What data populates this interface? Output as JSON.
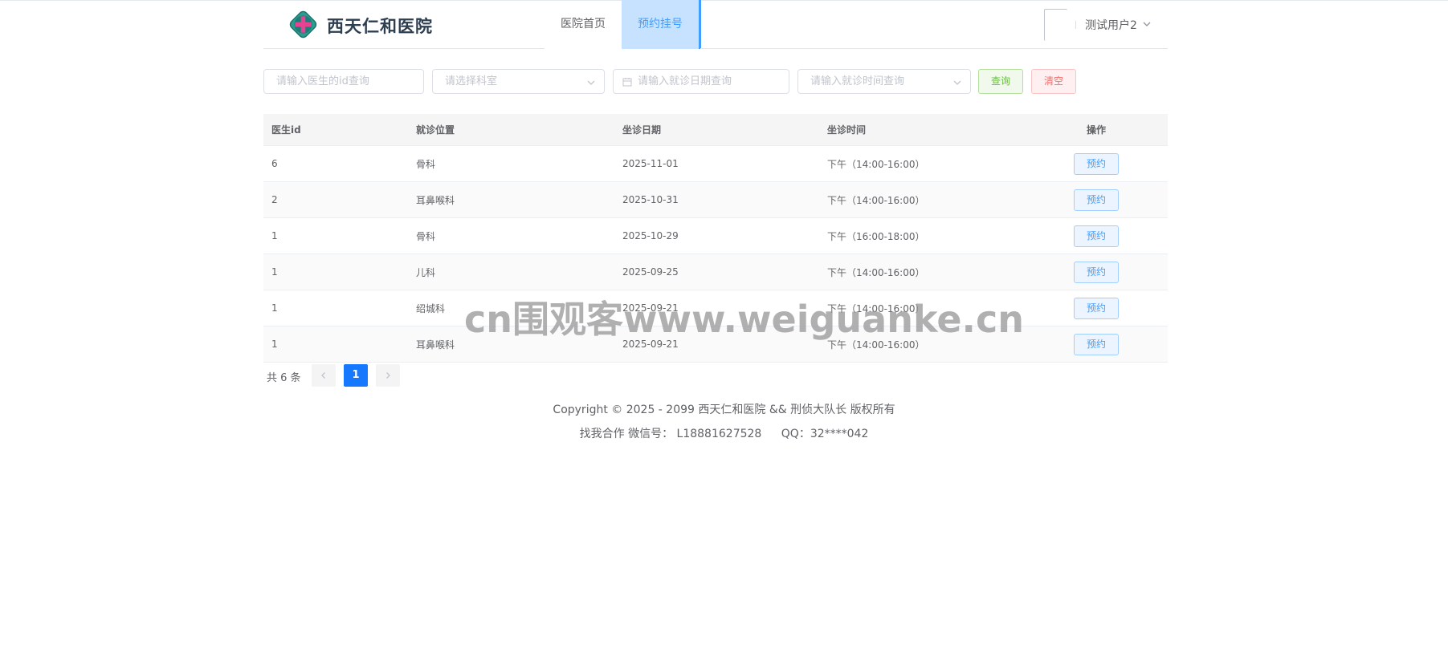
{
  "header": {
    "brand": "西天仁和医院",
    "nav": [
      {
        "label": "医院首页",
        "active": false
      },
      {
        "label": "预约挂号",
        "active": true
      }
    ],
    "user": "测试用户2"
  },
  "filters": {
    "doctor_id_placeholder": "请输入医生的id查询",
    "dept_placeholder": "请选择科室",
    "date_placeholder": "请输入就诊日期查询",
    "time_placeholder": "请输入就诊时间查询",
    "query_label": "查询",
    "clear_label": "清空"
  },
  "table": {
    "headers": [
      "医生id",
      "就诊位置",
      "坐诊日期",
      "坐诊时间",
      "操作"
    ],
    "rows": [
      {
        "id": "6",
        "location": "骨科",
        "date": "2025-11-01",
        "time": "下午（14:00-16:00）",
        "action": "预约"
      },
      {
        "id": "2",
        "location": "耳鼻喉科",
        "date": "2025-10-31",
        "time": "下午（14:00-16:00）",
        "action": "预约"
      },
      {
        "id": "1",
        "location": "骨科",
        "date": "2025-10-29",
        "time": "下午（16:00-18:00）",
        "action": "预约"
      },
      {
        "id": "1",
        "location": "儿科",
        "date": "2025-09-25",
        "time": "下午（14:00-16:00）",
        "action": "预约"
      },
      {
        "id": "1",
        "location": "绍城科",
        "date": "2025-09-21",
        "time": "下午（14:00-16:00）",
        "action": "预约"
      },
      {
        "id": "1",
        "location": "耳鼻喉科",
        "date": "2025-09-21",
        "time": "下午（14:00-16:00）",
        "action": "预约"
      }
    ]
  },
  "pagination": {
    "total": "共 6 条",
    "current": "1"
  },
  "footer": {
    "copyright": "Copyright © 2025 - 2099 西天仁和医院 && 刑侦大队长 版权所有",
    "contact_wechat": "找我合作 微信号： L18881627528",
    "contact_qq": "QQ：32****042"
  },
  "watermark": "cn围观客www.weiguanke.cn",
  "colors": {
    "primary": "#409eff",
    "active_nav_bg": "#c6e2ff",
    "success": "#67c23a",
    "danger": "#f56c6c",
    "page_active": "#1677ff"
  }
}
